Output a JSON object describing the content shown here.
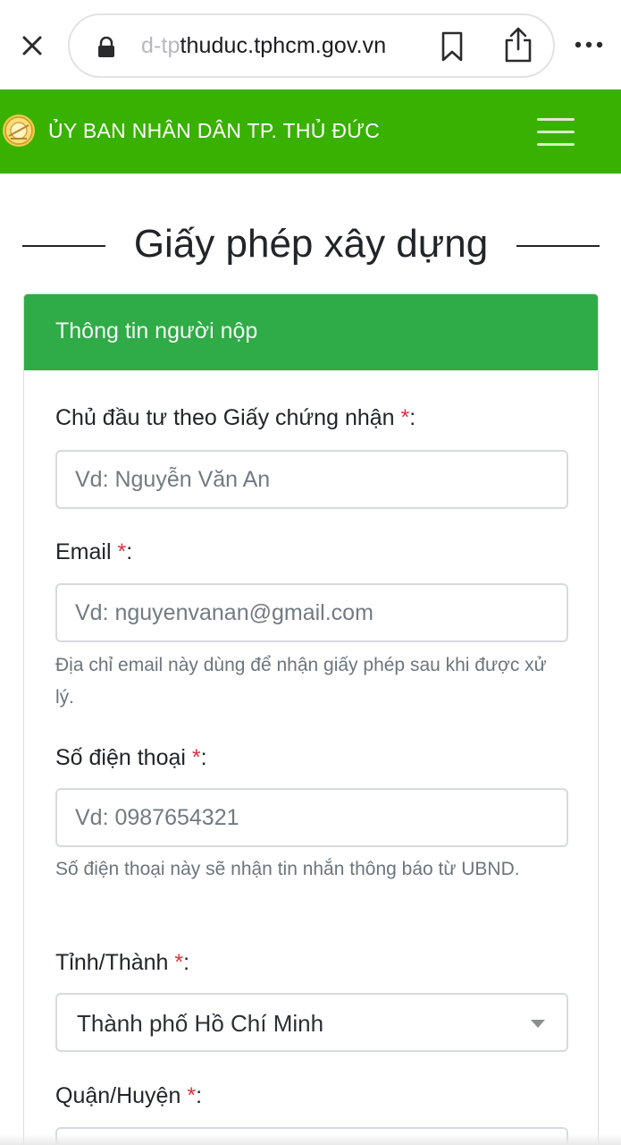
{
  "browser": {
    "url_faded": "d-tp",
    "url_main": "thuduc.tphcm.gov.vn",
    "close_icon": "close-icon",
    "lock_icon": "lock-icon",
    "bookmark_icon": "bookmark-icon",
    "share_icon": "share-icon",
    "more_icon": "more-icon"
  },
  "header": {
    "title": "ỦY BAN NHÂN DÂN TP. THỦ ĐỨC",
    "background": "#39b100",
    "logo_icon": "emblem-logo",
    "menu_icon": "hamburger-menu-icon"
  },
  "page": {
    "title": "Giấy phép xây dựng"
  },
  "form": {
    "section_title": "Thông tin người nộp",
    "section_color": "#2fab47",
    "required_mark": "*",
    "fields": {
      "owner": {
        "label": "Chủ đầu tư theo Giấy chứng nhận",
        "suffix": ":",
        "placeholder": "Vd: Nguyễn Văn An"
      },
      "email": {
        "label": "Email",
        "suffix": ":",
        "placeholder": "Vd: nguyenvanan@gmail.com",
        "help": "Địa chỉ email này dùng để nhận giấy phép sau khi được xử lý."
      },
      "phone": {
        "label": "Số điện thoại",
        "suffix": ":",
        "placeholder": "Vd: 0987654321",
        "help": "Số điện thoại này sẽ nhận tin nhắn thông báo từ UBND."
      },
      "province": {
        "label": "Tỉnh/Thành",
        "suffix": ":",
        "selected": "Thành phố Hồ Chí Minh"
      },
      "district": {
        "label": "Quận/Huyện",
        "suffix": ":"
      }
    }
  }
}
